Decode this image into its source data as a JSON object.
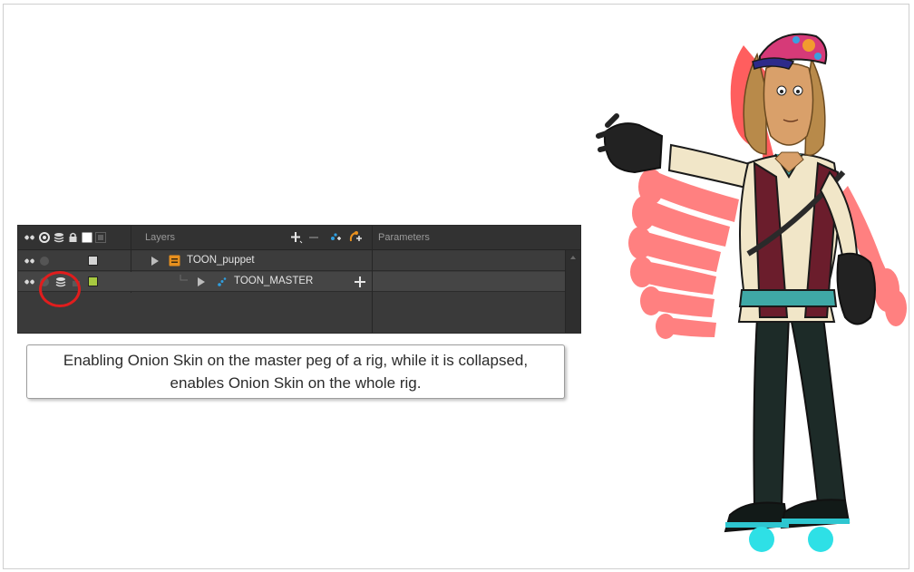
{
  "timeline": {
    "header": {
      "layers_label": "Layers",
      "parameters_label": "Parameters",
      "icons": [
        "onion-skin-toggle-icon",
        "enable-layer-icon",
        "stack-icon",
        "lock-icon",
        "color-swatch-icon",
        "expand-icon",
        "add-layer-icon",
        "remove-layer-icon",
        "add-peg-icon",
        "add-effect-icon"
      ]
    },
    "layers": [
      {
        "name": "TOON_puppet",
        "icon": "group-icon",
        "color": "#d4d4d4",
        "expanded": false
      },
      {
        "name": "TOON_MASTER",
        "icon": "peg-icon",
        "color": "#a7c940",
        "expanded": false,
        "onion_skin_enabled": true
      }
    ]
  },
  "caption": {
    "text": "Enabling Onion Skin on the master peg of a rig, while it is collapsed, enables Onion Skin on the whole rig."
  },
  "colors": {
    "highlight": "#e01d1d",
    "panel_bg": "#3a3a3a",
    "onion_skin_red": "#ff1a1a",
    "group_orange": "#e8901e",
    "peg_blue": "#2f9fe0"
  }
}
